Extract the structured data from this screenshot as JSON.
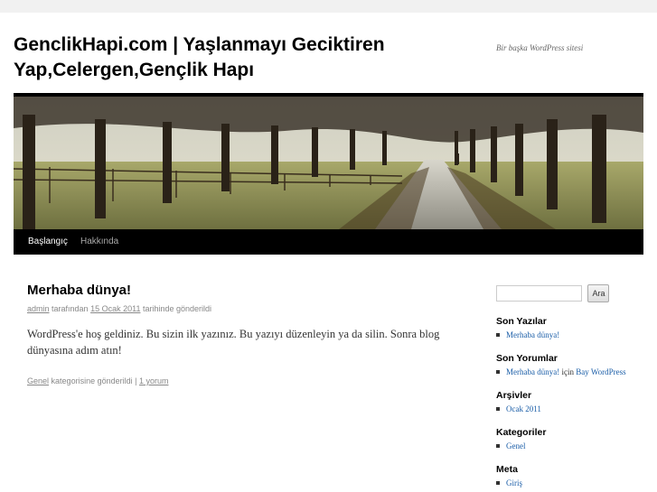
{
  "site": {
    "title": "GenclikHapi.com | Yaşlanmayı Geciktiren Yap,Celergen,Gençlik Hapı",
    "description": "Bir başka WordPress sitesi"
  },
  "nav": {
    "items": [
      {
        "label": "Başlangıç",
        "current": true
      },
      {
        "label": "Hakkında",
        "current": false
      }
    ]
  },
  "post": {
    "title": "Merhaba dünya!",
    "author": "admin",
    "by_text": "tarafından",
    "date": "15 Ocak 2011",
    "posted_text": "tarihinde gönderildi",
    "content": "WordPress'e hoş geldiniz. Bu sizin ilk yazınız. Bu yazıyı düzenleyin ya da silin. Sonra blog dünyasına adım atın!",
    "category": "Genel",
    "category_text": "kategorisine gönderildi",
    "separator": "|",
    "comments": "1 yorum"
  },
  "sidebar": {
    "search": {
      "placeholder": "",
      "button": "Ara"
    },
    "recent_posts": {
      "title": "Son Yazılar",
      "items": [
        "Merhaba dünya!"
      ]
    },
    "recent_comments": {
      "title": "Son Yorumlar",
      "post_link": "Merhaba dünya!",
      "on_text": "için",
      "author": "Bay WordPress"
    },
    "archives": {
      "title": "Arşivler",
      "items": [
        "Ocak 2011"
      ]
    },
    "categories": {
      "title": "Kategoriler",
      "items": [
        "Genel"
      ]
    },
    "meta": {
      "title": "Meta",
      "items": [
        "Giriş"
      ]
    }
  }
}
